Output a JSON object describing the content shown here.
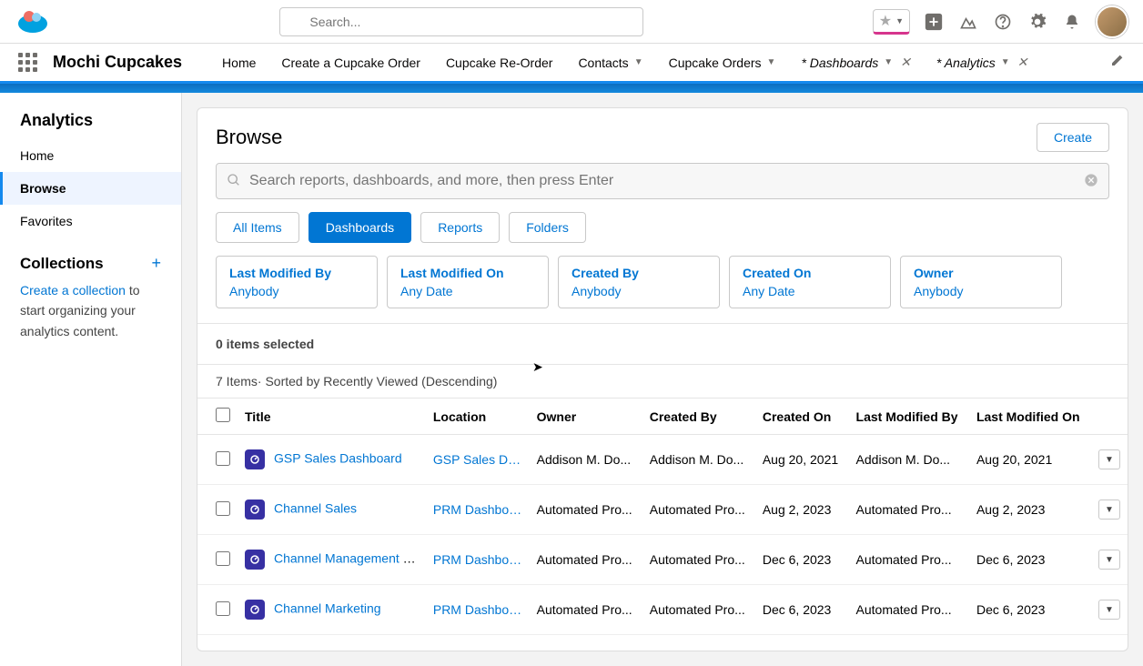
{
  "header": {
    "search_placeholder": "Search..."
  },
  "nav": {
    "app_name": "Mochi Cupcakes",
    "tabs": [
      {
        "label": "Home",
        "dropdown": false,
        "close": false
      },
      {
        "label": "Create a Cupcake Order",
        "dropdown": false,
        "close": false
      },
      {
        "label": "Cupcake Re-Order",
        "dropdown": false,
        "close": false
      },
      {
        "label": "Contacts",
        "dropdown": true,
        "close": false
      },
      {
        "label": "Cupcake Orders",
        "dropdown": true,
        "close": false
      },
      {
        "label": "* Dashboards",
        "dropdown": true,
        "close": true,
        "italic": true
      },
      {
        "label": "* Analytics",
        "dropdown": true,
        "close": true,
        "italic": true
      }
    ]
  },
  "sidebar": {
    "title": "Analytics",
    "items": [
      {
        "label": "Home"
      },
      {
        "label": "Browse"
      },
      {
        "label": "Favorites"
      }
    ],
    "collections": {
      "title": "Collections",
      "link": "Create a collection",
      "text_prefix": " to start organizing your analytics content."
    }
  },
  "browse": {
    "title": "Browse",
    "create_label": "Create",
    "search_placeholder": "Search reports, dashboards, and more, then press Enter",
    "chips": [
      "All Items",
      "Dashboards",
      "Reports",
      "Folders"
    ],
    "filters": [
      {
        "label": "Last Modified By",
        "value": "Anybody"
      },
      {
        "label": "Last Modified On",
        "value": "Any Date"
      },
      {
        "label": "Created By",
        "value": "Anybody"
      },
      {
        "label": "Created On",
        "value": "Any Date"
      },
      {
        "label": "Owner",
        "value": "Anybody"
      }
    ],
    "selected_text": "0 items selected",
    "sort_text": "7 Items· Sorted by Recently Viewed (Descending)",
    "columns": [
      "Title",
      "Location",
      "Owner",
      "Created By",
      "Created On",
      "Last Modified By",
      "Last Modified On"
    ],
    "rows": [
      {
        "title": "GSP Sales Dashboard",
        "location": "GSP Sales Das...",
        "owner": "Addison M. Do...",
        "created_by": "Addison M. Do...",
        "created_on": "Aug 20, 2021",
        "modified_by": "Addison M. Do...",
        "modified_on": "Aug 20, 2021"
      },
      {
        "title": "Channel Sales",
        "location": "PRM Dashboar...",
        "owner": "Automated Pro...",
        "created_by": "Automated Pro...",
        "created_on": "Aug 2, 2023",
        "modified_by": "Automated Pro...",
        "modified_on": "Aug 2, 2023"
      },
      {
        "title": "Channel Management Ov...",
        "location": "PRM Dashboar...",
        "owner": "Automated Pro...",
        "created_by": "Automated Pro...",
        "created_on": "Dec 6, 2023",
        "modified_by": "Automated Pro...",
        "modified_on": "Dec 6, 2023"
      },
      {
        "title": "Channel Marketing",
        "location": "PRM Dashboar...",
        "owner": "Automated Pro...",
        "created_by": "Automated Pro...",
        "created_on": "Dec 6, 2023",
        "modified_by": "Automated Pro...",
        "modified_on": "Dec 6, 2023"
      }
    ]
  }
}
